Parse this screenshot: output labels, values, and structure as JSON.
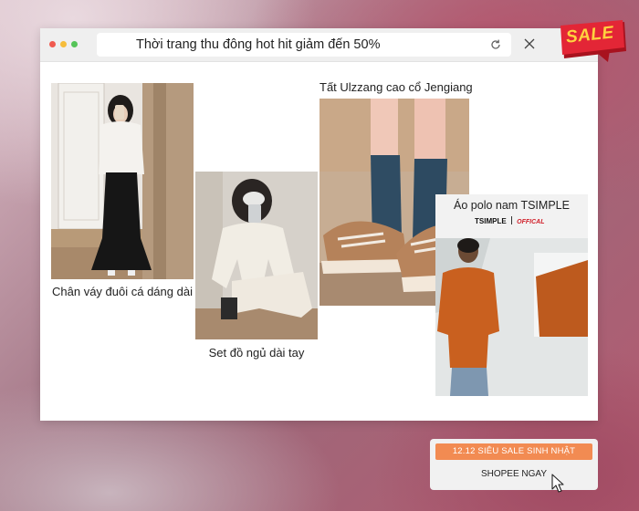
{
  "browser": {
    "address_text": "Thời trang thu đông hot hit giảm đến 50%"
  },
  "products": [
    {
      "caption": "Chân váy đuôi cá dáng dài"
    },
    {
      "caption": "Set đồ ngủ dài tay"
    },
    {
      "caption": "Tất Ulzzang cao cổ Jengiang"
    },
    {
      "caption": "Áo polo nam TSIMPLE"
    }
  ],
  "polo_brand": {
    "name": "TSIMPLE",
    "tag": "OFFICAL"
  },
  "sale_badge": {
    "text": "SALE"
  },
  "cta": {
    "promo_label": "12.12 SIÊU SALE SINH NHẬT",
    "shop_label": "SHOPEE NGAY"
  },
  "colors": {
    "accent_orange": "#f28b52",
    "sale_red": "#e32636",
    "sale_yellow": "#ffd23f"
  }
}
